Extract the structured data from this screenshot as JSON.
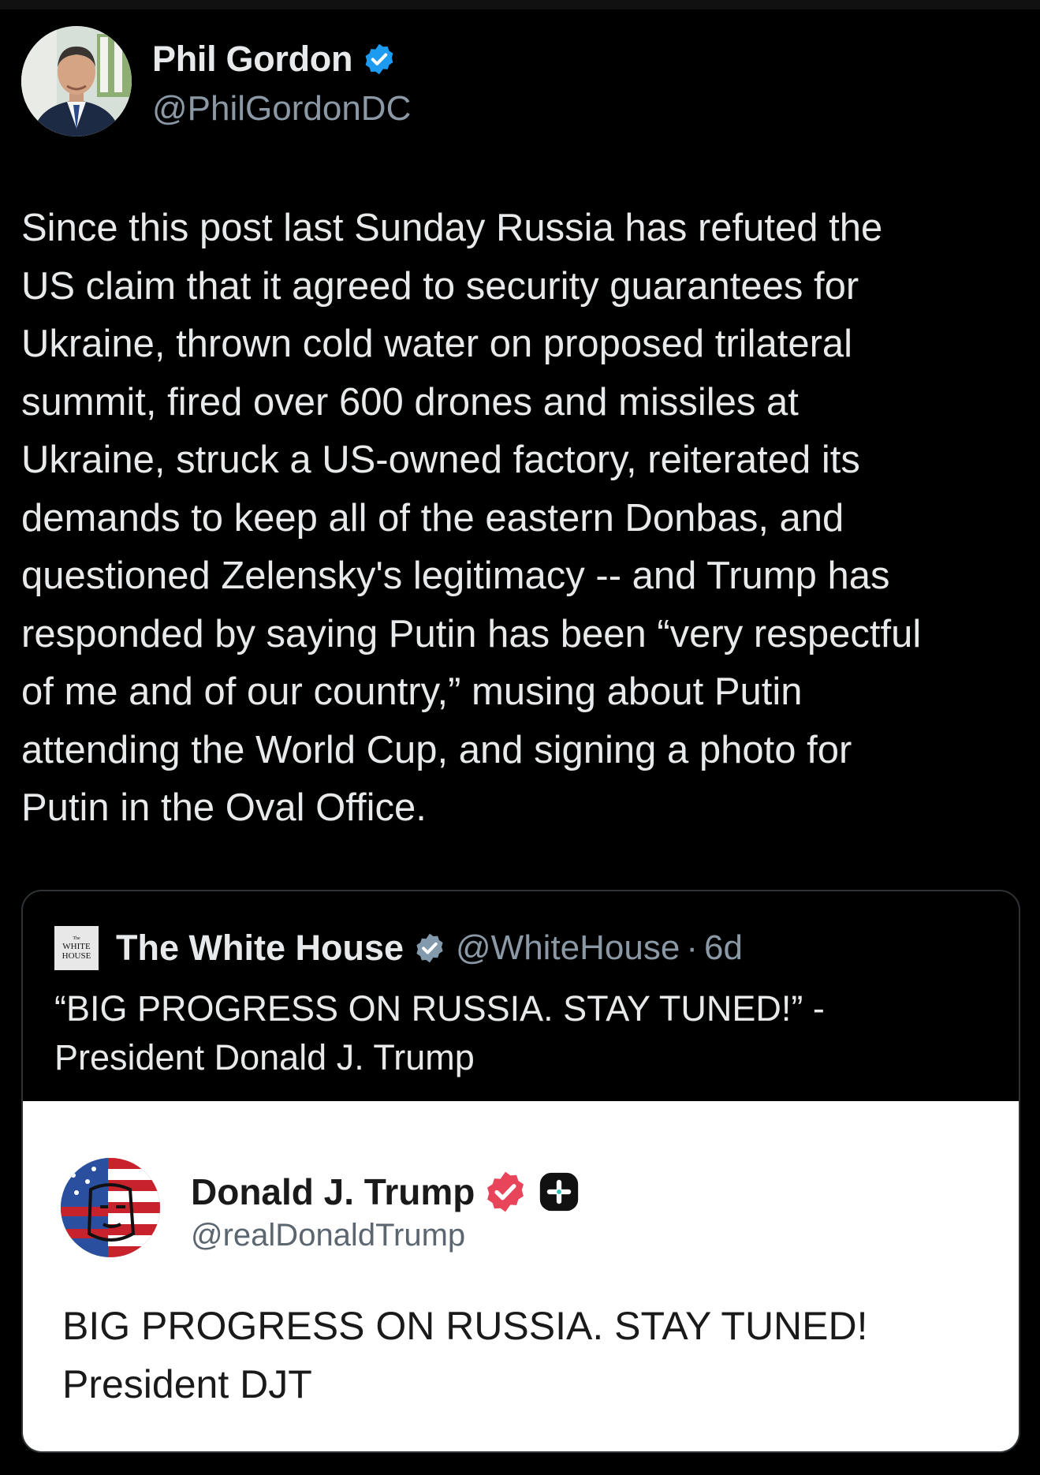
{
  "author": {
    "display_name": "Phil Gordon",
    "handle": "@PhilGordonDC",
    "verified_color": "#1d9bf0",
    "avatar_icon": "profile-photo"
  },
  "tweet": {
    "text": "Since this post last Sunday Russia has refuted the\nUS claim that it agreed to security guarantees for\nUkraine, thrown cold water on proposed trilateral\nsummit, fired over 600 drones and missiles at\nUkraine, struck a US-owned factory, reiterated its\ndemands to keep all of the eastern Donbas, and\nquestioned Zelensky's legitimacy -- and Trump has\nresponded by saying Putin has been “very respectful\nof me and of our country,” musing about Putin\nattending the World Cup, and signing a photo for\nPutin in the Oval Office."
  },
  "quoted": {
    "logo_line1": "The",
    "logo_line2": "WHITE",
    "logo_line3": "HOUSE",
    "display_name": "The White House",
    "handle": "@WhiteHouse",
    "separator": "·",
    "time": "6d",
    "text": "“BIG PROGRESS ON RUSSIA. STAY TUNED!” -\nPresident Donald J. Trump",
    "verified_color": "#829aab",
    "embedded": {
      "display_name": "Donald J. Trump",
      "handle": "@realDonaldTrump",
      "badge_color": "#e8455a",
      "text": "BIG PROGRESS ON RUSSIA. STAY TUNED!\nPresident DJT"
    }
  }
}
